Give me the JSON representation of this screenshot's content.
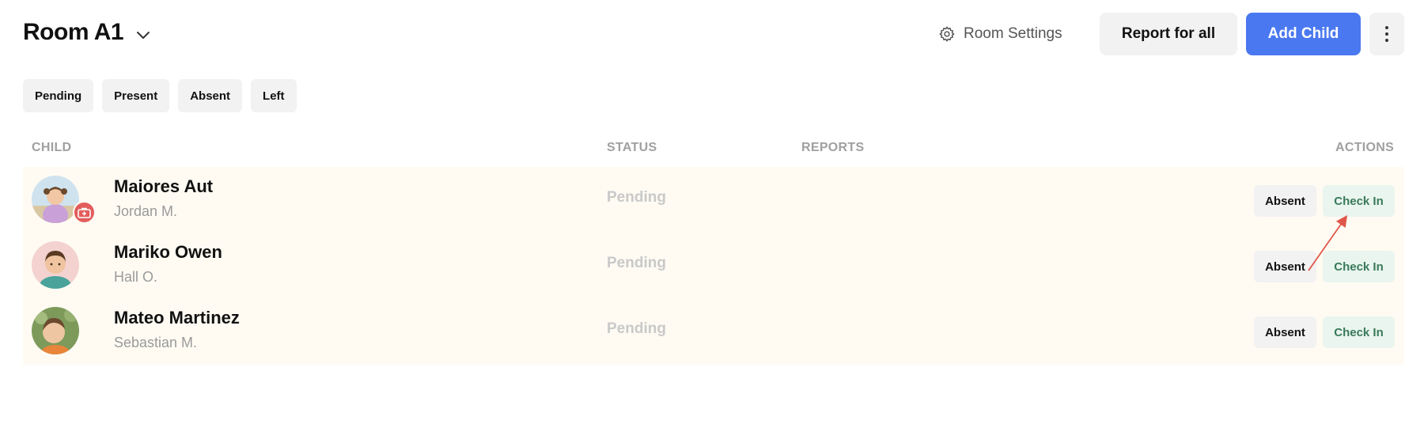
{
  "header": {
    "room_title": "Room A1",
    "room_settings_label": "Room Settings",
    "report_all_label": "Report for all",
    "add_child_label": "Add Child"
  },
  "filters": [
    "Pending",
    "Present",
    "Absent",
    "Left"
  ],
  "columns": {
    "child": "CHILD",
    "status": "STATUS",
    "reports": "REPORTS",
    "actions": "ACTIONS"
  },
  "children": [
    {
      "name": "Maiores Aut",
      "parent": "Jordan M.",
      "status": "Pending",
      "absent_label": "Absent",
      "checkin_label": "Check In",
      "has_medical_badge": true
    },
    {
      "name": "Mariko Owen",
      "parent": "Hall O.",
      "status": "Pending",
      "absent_label": "Absent",
      "checkin_label": "Check In",
      "has_medical_badge": false
    },
    {
      "name": "Mateo Martinez",
      "parent": "Sebastian M.",
      "status": "Pending",
      "absent_label": "Absent",
      "checkin_label": "Check In",
      "has_medical_badge": false
    }
  ],
  "colors": {
    "primary": "#4a78f0",
    "row_background": "#fffbf3",
    "checkin_bg": "#e9f5ee",
    "checkin_text": "#3a7a5a",
    "badge": "#e25c5c",
    "annotation_arrow": "#e0564a"
  },
  "icons": {
    "room_dropdown": "chevron-down-icon",
    "settings": "gear-icon",
    "more": "more-vertical-icon",
    "medical": "medical-kit-icon"
  }
}
